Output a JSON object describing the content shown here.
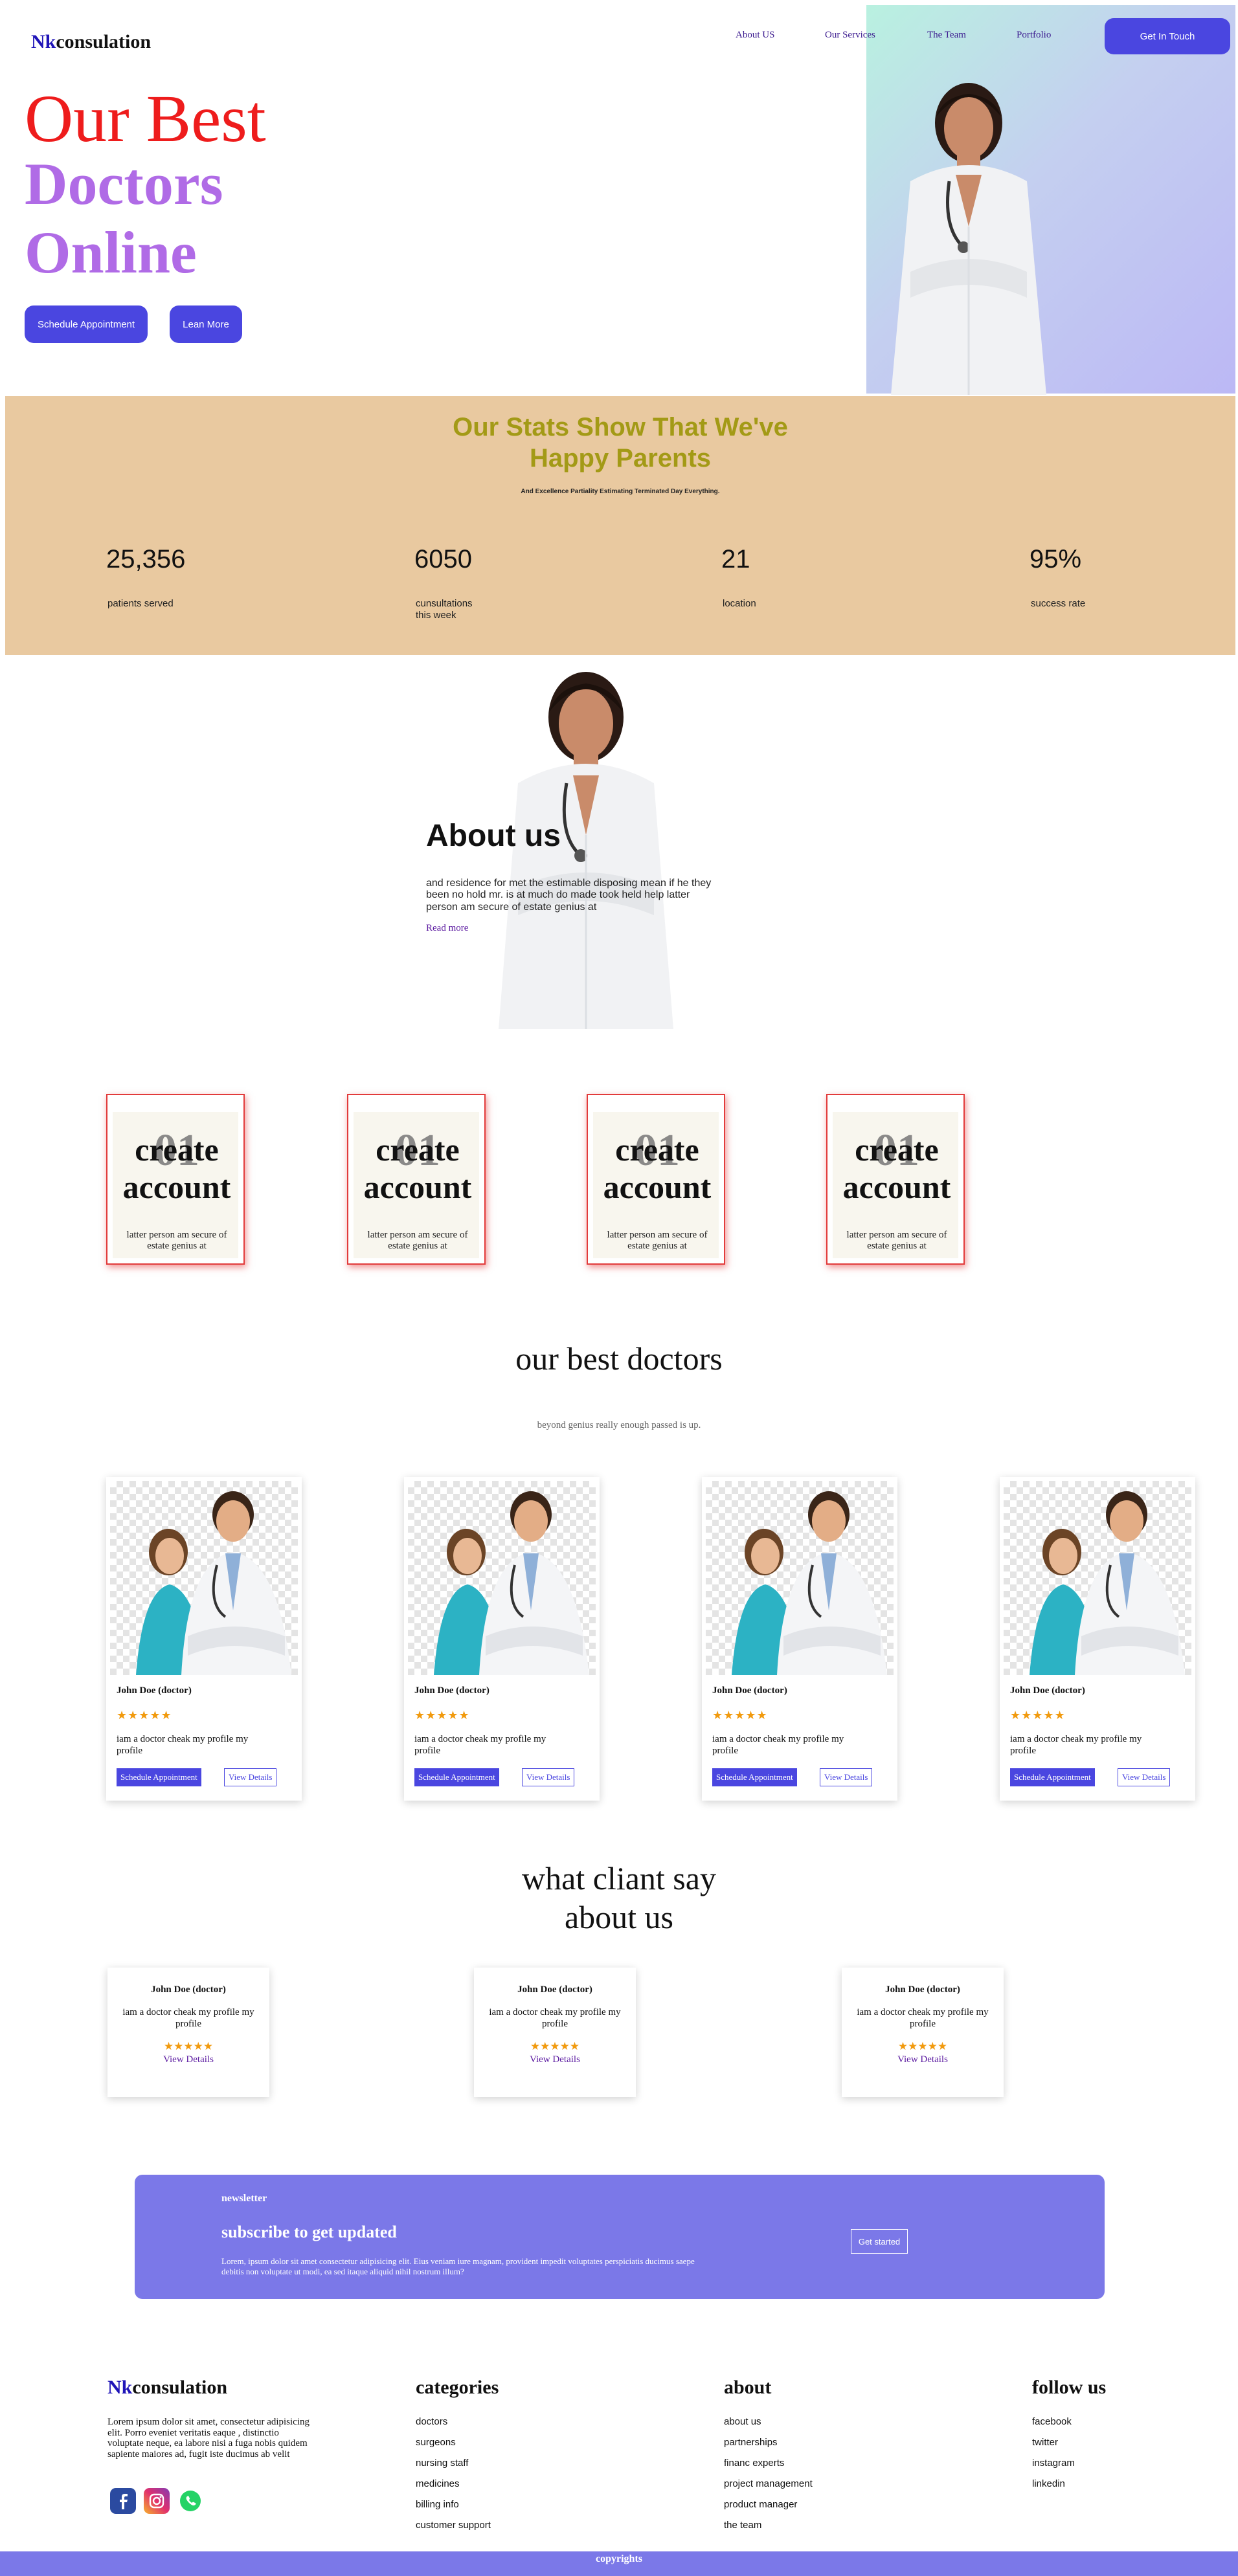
{
  "header": {
    "logo_nk": "Nk",
    "logo_rest": "consulation",
    "nav": [
      "About US",
      "Our Services",
      "The Team",
      "Portfolio"
    ],
    "cta": "Get In Touch"
  },
  "hero": {
    "line1": "Our Best",
    "line2": "Doctors",
    "line3": "Online",
    "btn_schedule": "Schedule Appointment",
    "btn_learn": "Lean More"
  },
  "stats": {
    "title_line1": "Our Stats Show That We've",
    "title_line2": "Happy Parents",
    "subtitle": "And Excellence Partiality Estimating Terminated Day Everything.",
    "items": [
      {
        "value": "25,356",
        "label": "patients served"
      },
      {
        "value": "6050",
        "label": "cunsultations this week"
      },
      {
        "value": "21",
        "label": "location"
      },
      {
        "value": "95%",
        "label": "success rate"
      }
    ]
  },
  "about": {
    "title": "About us",
    "text": "and residence for met the estimable disposing mean if he they been no hold mr. is at much do made took held help latter person am secure of estate genius at",
    "link": "Read more"
  },
  "features": [
    {
      "num": "01",
      "title": "create account",
      "text": "latter person am secure of estate genius at"
    },
    {
      "num": "01",
      "title": "create account",
      "text": "latter person am secure of estate genius at"
    },
    {
      "num": "01",
      "title": "create account",
      "text": "latter person am secure of estate genius at"
    },
    {
      "num": "01",
      "title": "create account",
      "text": "latter person am secure of estate genius at"
    }
  ],
  "doctors": {
    "title": "our best doctors",
    "subtitle": "beyond genius really enough passed is up.",
    "cards": [
      {
        "name": "John Doe (doctor)",
        "stars": "★★★★★",
        "desc": "iam a doctor cheak my profile my profile",
        "btn_schedule": "Schedule Appointment",
        "btn_view": "View Details"
      },
      {
        "name": "John Doe (doctor)",
        "stars": "★★★★★",
        "desc": "iam a doctor cheak my profile my profile",
        "btn_schedule": "Schedule Appointment",
        "btn_view": "View Details"
      },
      {
        "name": "John Doe (doctor)",
        "stars": "★★★★★",
        "desc": "iam a doctor cheak my profile my profile",
        "btn_schedule": "Schedule Appointment",
        "btn_view": "View Details"
      },
      {
        "name": "John Doe (doctor)",
        "stars": "★★★★★",
        "desc": "iam a doctor cheak my profile my profile",
        "btn_schedule": "Schedule Appointment",
        "btn_view": "View Details"
      }
    ]
  },
  "testimonials": {
    "title_line1": "what cliant say",
    "title_line2": "about us",
    "cards": [
      {
        "name": "John Doe (doctor)",
        "desc": "iam a doctor cheak my profile my profile",
        "stars": "★★★★★",
        "link": "View Details"
      },
      {
        "name": "John Doe (doctor)",
        "desc": "iam a doctor cheak my profile my profile",
        "stars": "★★★★★",
        "link": "View Details"
      },
      {
        "name": "John Doe (doctor)",
        "desc": "iam a doctor cheak my profile my profile",
        "stars": "★★★★★",
        "link": "View Details"
      }
    ]
  },
  "newsletter": {
    "label": "newsletter",
    "title": "subscribe to get updated",
    "text": "Lorem, ipsum dolor sit amet consectetur adipisicing elit. Eius veniam iure magnam, provident impedit voluptates perspiciatis ducimus saepe debitis non voluptate ut modi, ea sed itaque aliquid nihil nostrum illum?",
    "button": "Get started"
  },
  "footer": {
    "logo_nk": "Nk",
    "logo_rest": "consulation",
    "about_text": "Lorem ipsum dolor sit amet, consectetur adipisicing elit. Porro eveniet veritatis eaque , distinctio voluptate neque, ea labore nisi a fuga nobis quidem sapiente maiores ad, fugit iste ducimus ab velit",
    "categories_title": "categories",
    "categories": [
      "doctors",
      "surgeons",
      "nursing staff",
      "medicines",
      "billing info",
      "customer support"
    ],
    "about_title": "about",
    "about_links": [
      "about us",
      "partnerships",
      "financ experts",
      "project management",
      "product manager",
      "the team"
    ],
    "follow_title": "follow us",
    "follow_links": [
      "facebook",
      "twitter",
      "instagram",
      "linkedin"
    ],
    "social_icons": [
      "facebook-icon",
      "instagram-icon",
      "whatsapp-icon"
    ],
    "copyright": "copyrights"
  }
}
